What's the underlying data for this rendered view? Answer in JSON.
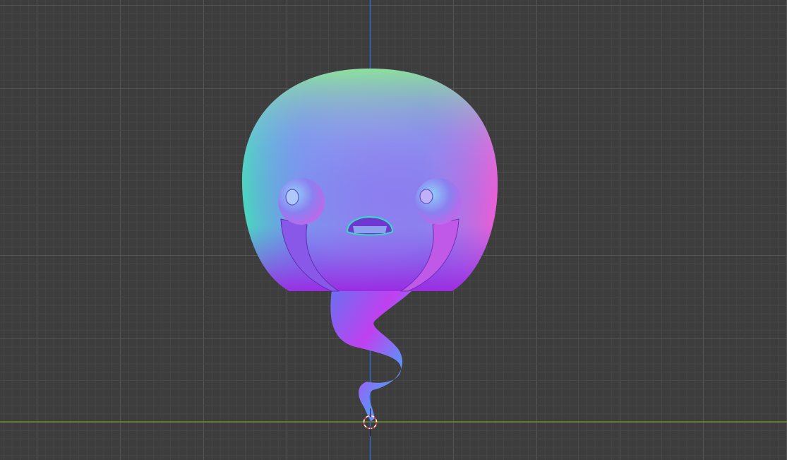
{
  "viewport": {
    "background_color": "#3d3d3d",
    "grid_minor_color": "#474747",
    "grid_major_color": "#545454",
    "x_axis_color": "#6b8e23",
    "y_axis_color": "#2f6fd6"
  },
  "object": {
    "shading": "normal-map",
    "icon": "ghost-character"
  },
  "origin_marker": {
    "icon": "3d-cursor-icon",
    "colors": [
      "#e03030",
      "#ffffff"
    ]
  }
}
